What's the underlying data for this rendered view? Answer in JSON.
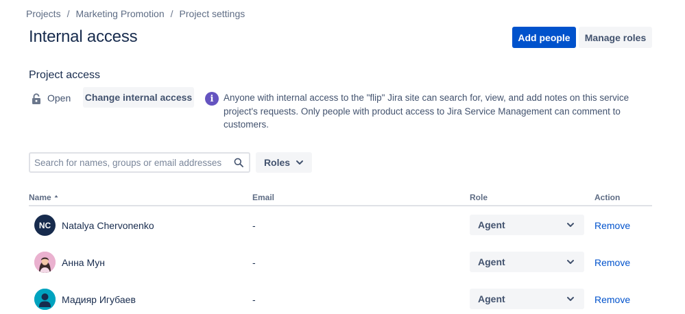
{
  "breadcrumb": {
    "items": [
      "Projects",
      "Marketing Promotion",
      "Project settings"
    ],
    "separator": "/"
  },
  "page": {
    "title": "Internal access"
  },
  "header_actions": {
    "add_people": "Add people",
    "manage_roles": "Manage roles"
  },
  "project_access": {
    "title": "Project access",
    "status": "Open",
    "change_button": "Change internal access",
    "info_icon_glyph": "i",
    "info_text": "Anyone with internal access to the \"flip\" Jira site can search for, view, and add notes on this service project's requests. Only people with product access to Jira Service Management can comment to customers."
  },
  "filters": {
    "search_placeholder": "Search for names, groups or email addresses",
    "search_value": "",
    "roles_label": "Roles"
  },
  "table": {
    "columns": {
      "name": "Name",
      "email": "Email",
      "role": "Role",
      "action": "Action"
    },
    "rows": [
      {
        "name": "Natalya Chervonenko",
        "initials": "NC",
        "email": "-",
        "role": "Agent",
        "action": "Remove"
      },
      {
        "name": "Анна Мун",
        "initials": "",
        "email": "-",
        "role": "Agent",
        "action": "Remove"
      },
      {
        "name": "Мадияр Игубаев",
        "initials": "",
        "email": "-",
        "role": "Agent",
        "action": "Remove"
      }
    ]
  },
  "colors": {
    "primary": "#0052cc",
    "info": "#6554c0",
    "text": "#172b4d",
    "subtle_bg": "#f4f5f7"
  },
  "icons": {
    "status": "lock-icon",
    "info": "info-icon",
    "search": "search-icon",
    "roles_chevron": "chevron-down-icon",
    "sort": "sort-ascending-icon"
  }
}
